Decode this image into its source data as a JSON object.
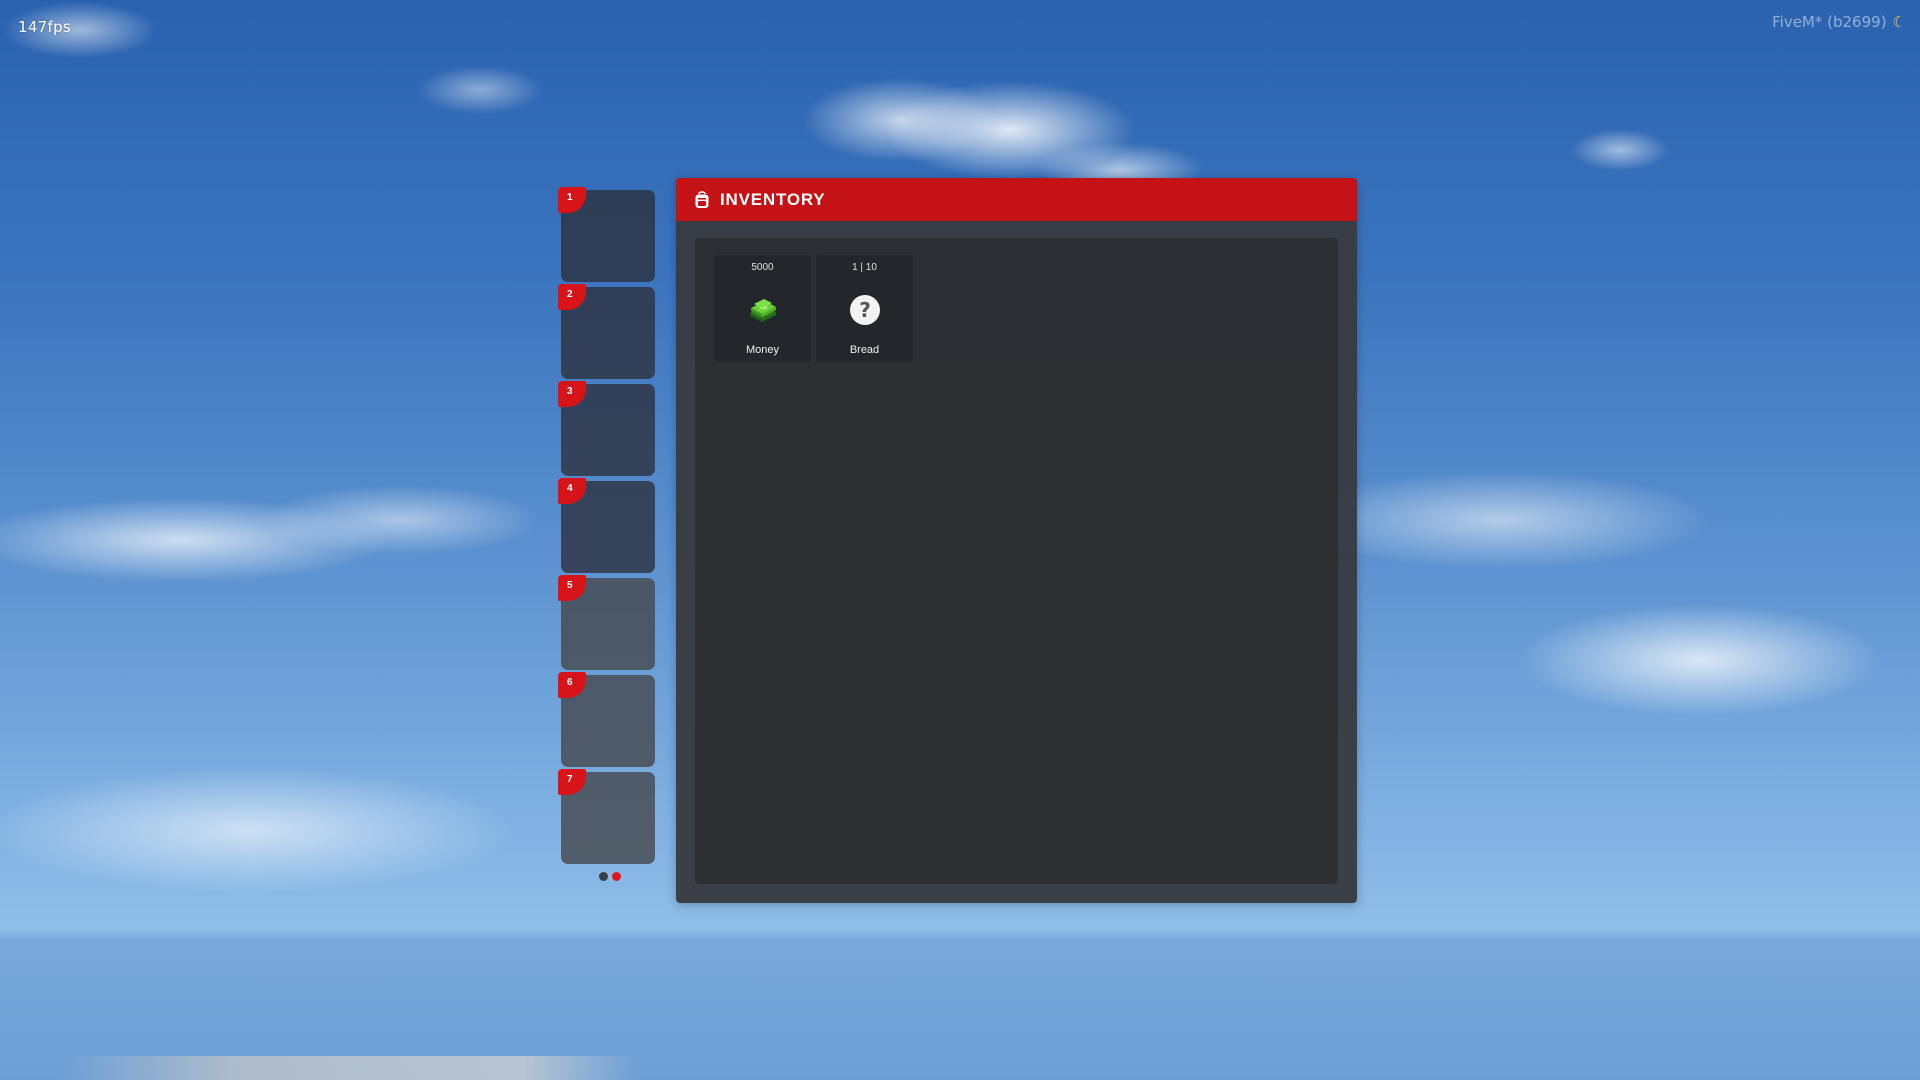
{
  "overlay": {
    "fps": "147fps",
    "build": "FiveM* (b2699)",
    "moon_icon": "crescent-moon-icon"
  },
  "hotbar": {
    "slots": [
      {
        "number": "1"
      },
      {
        "number": "2"
      },
      {
        "number": "3"
      },
      {
        "number": "4"
      },
      {
        "number": "5"
      },
      {
        "number": "6"
      },
      {
        "number": "7"
      }
    ],
    "pages": 2,
    "active_page": 2
  },
  "inventory": {
    "title": "INVENTORY",
    "icon": "backpack-icon",
    "items": [
      {
        "name": "Money",
        "count": "5000",
        "icon": "cash-stack-icon"
      },
      {
        "name": "Bread",
        "count": "1 | 10",
        "icon": "question-mark-icon"
      }
    ]
  },
  "colors": {
    "accent_red": "#c41216",
    "badge_red": "#d71419",
    "panel": "#383a3f",
    "slot": "#23262b"
  }
}
